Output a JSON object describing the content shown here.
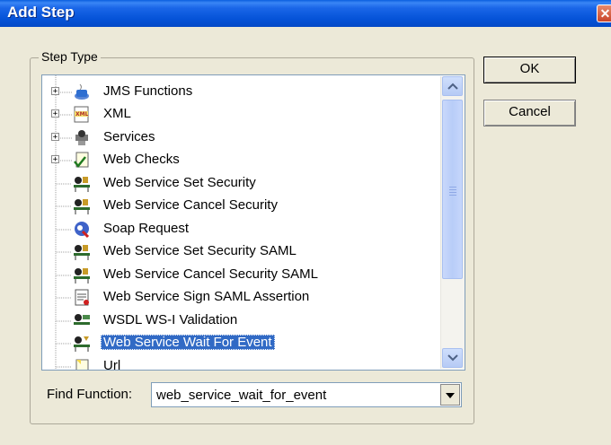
{
  "window": {
    "title": "Add Step",
    "close_label": "✕"
  },
  "group": {
    "label": "Step Type"
  },
  "tree": {
    "items": [
      {
        "label": "JMS Functions",
        "expandable": true,
        "icon": "jms-icon"
      },
      {
        "label": "XML",
        "expandable": true,
        "icon": "xml-icon"
      },
      {
        "label": "Services",
        "expandable": true,
        "icon": "services-icon"
      },
      {
        "label": "Web Checks",
        "expandable": true,
        "icon": "web-checks-icon"
      },
      {
        "label": "Web Service Set Security",
        "expandable": false,
        "icon": "security-icon"
      },
      {
        "label": "Web Service Cancel Security",
        "expandable": false,
        "icon": "security-icon"
      },
      {
        "label": "Soap Request",
        "expandable": false,
        "icon": "soap-icon"
      },
      {
        "label": "Web Service Set Security SAML",
        "expandable": false,
        "icon": "security-icon"
      },
      {
        "label": "Web Service Cancel Security SAML",
        "expandable": false,
        "icon": "security-icon"
      },
      {
        "label": "Web Service Sign SAML Assertion",
        "expandable": false,
        "icon": "sign-icon"
      },
      {
        "label": "WSDL WS-I Validation",
        "expandable": false,
        "icon": "wsdl-icon"
      },
      {
        "label": "Web Service Wait For Event",
        "expandable": false,
        "icon": "wait-icon",
        "selected": true
      },
      {
        "label": "Url",
        "expandable": false,
        "icon": "url-icon"
      }
    ]
  },
  "find": {
    "label": "Find Function:",
    "value": "web_service_wait_for_event"
  },
  "buttons": {
    "ok": "OK",
    "cancel": "Cancel"
  },
  "colors": {
    "title_bar": "#0553d8",
    "selection": "#316ac5",
    "dialog_bg": "#ece9d8"
  }
}
